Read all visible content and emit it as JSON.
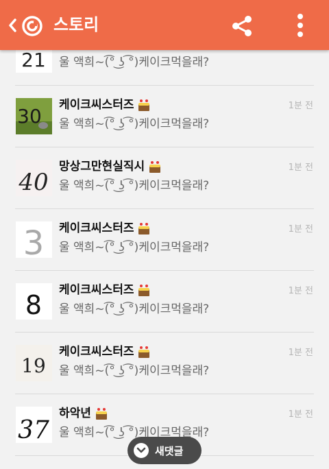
{
  "header": {
    "title": "스토리"
  },
  "icons": {
    "back": "chevron-left-icon",
    "logo": "app-logo-icon",
    "share": "share-icon",
    "more": "more-vertical-icon",
    "cake": "cake-icon",
    "new_comment": "chevron-down-icon"
  },
  "colors": {
    "header_bg": "#ef6b48",
    "button_bg": "#4a4a4a"
  },
  "comments": [
    {
      "thumb": "21",
      "name": "",
      "time": "",
      "message": "울 액희~(͡° ͜ʖ ͡°)케이크먹을래?"
    },
    {
      "thumb": "30",
      "name": "케이크씨스터즈",
      "time": "1분 전",
      "message": "울 액희~(͡° ͜ʖ ͡°)케이크먹을래?"
    },
    {
      "thumb": "40",
      "name": "망상그만현실직시",
      "time": "1분 전",
      "message": "울 액희~(͡° ͜ʖ ͡°)케이크먹을래?"
    },
    {
      "thumb": "3",
      "name": "케이크씨스터즈",
      "time": "1분 전",
      "message": "울 액희~(͡° ͜ʖ ͡°)케이크먹을래?"
    },
    {
      "thumb": "8",
      "name": "케이크씨스터즈",
      "time": "1분 전",
      "message": "울 액희~(͡° ͜ʖ ͡°)케이크먹을래?"
    },
    {
      "thumb": "19",
      "name": "케이크씨스터즈",
      "time": "1분 전",
      "message": "울 액희~(͡° ͜ʖ ͡°)케이크먹을래?"
    },
    {
      "thumb": "37",
      "name": "하악년",
      "time": "1분 전",
      "message": "울 액희~(͡° ͜ʖ ͡°)케이크먹을래?"
    }
  ],
  "new_comment_button": {
    "label": "새댓글"
  }
}
